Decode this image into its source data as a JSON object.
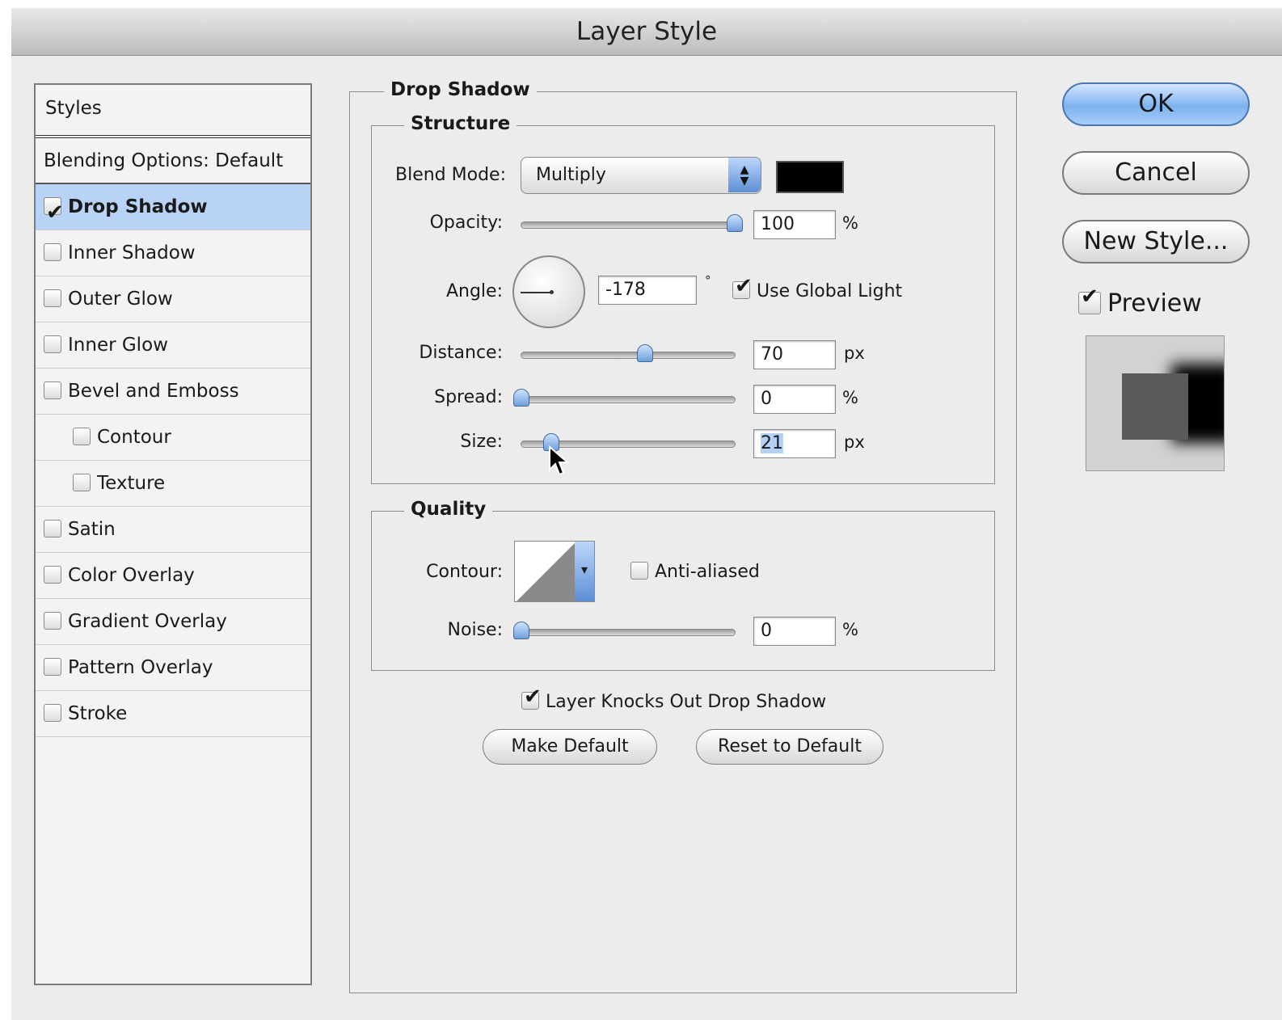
{
  "window": {
    "title": "Layer Style"
  },
  "styles_panel": {
    "header": "Styles",
    "blending_options": "Blending Options: Default",
    "items": [
      {
        "label": "Drop Shadow",
        "checked": true,
        "selected": true
      },
      {
        "label": "Inner Shadow",
        "checked": false
      },
      {
        "label": "Outer Glow",
        "checked": false
      },
      {
        "label": "Inner Glow",
        "checked": false
      },
      {
        "label": "Bevel and Emboss",
        "checked": false
      },
      {
        "label": "Contour",
        "checked": false,
        "indent": true
      },
      {
        "label": "Texture",
        "checked": false,
        "indent": true
      },
      {
        "label": "Satin",
        "checked": false
      },
      {
        "label": "Color Overlay",
        "checked": false
      },
      {
        "label": "Gradient Overlay",
        "checked": false
      },
      {
        "label": "Pattern Overlay",
        "checked": false
      },
      {
        "label": "Stroke",
        "checked": false
      }
    ]
  },
  "drop_shadow": {
    "title": "Drop Shadow",
    "structure": {
      "title": "Structure",
      "blend_mode": {
        "label": "Blend Mode:",
        "value": "Multiply",
        "color": "#000000"
      },
      "opacity": {
        "label": "Opacity:",
        "value": "100",
        "unit": "%",
        "slider_fraction": 1.0
      },
      "angle": {
        "label": "Angle:",
        "value": "-178",
        "unit": "°"
      },
      "use_global_light": {
        "label": "Use Global Light",
        "checked": true
      },
      "distance": {
        "label": "Distance:",
        "value": "70",
        "unit": "px",
        "slider_fraction": 0.58
      },
      "spread": {
        "label": "Spread:",
        "value": "0",
        "unit": "%",
        "slider_fraction": 0.0
      },
      "size": {
        "label": "Size:",
        "value": "21",
        "unit": "px",
        "slider_fraction": 0.14
      }
    },
    "quality": {
      "title": "Quality",
      "contour_label": "Contour:",
      "anti_aliased": {
        "label": "Anti-aliased",
        "checked": false
      },
      "noise": {
        "label": "Noise:",
        "value": "0",
        "unit": "%",
        "slider_fraction": 0.0
      }
    },
    "layer_knocks_out": {
      "label": "Layer Knocks Out Drop Shadow",
      "checked": true
    },
    "make_default": "Make Default",
    "reset_default": "Reset to Default"
  },
  "actions": {
    "ok": "OK",
    "cancel": "Cancel",
    "new_style": "New Style...",
    "preview": {
      "label": "Preview",
      "checked": true
    }
  },
  "colors": {
    "accent": "#7eb2ef",
    "selection": "#b9d3f7"
  }
}
